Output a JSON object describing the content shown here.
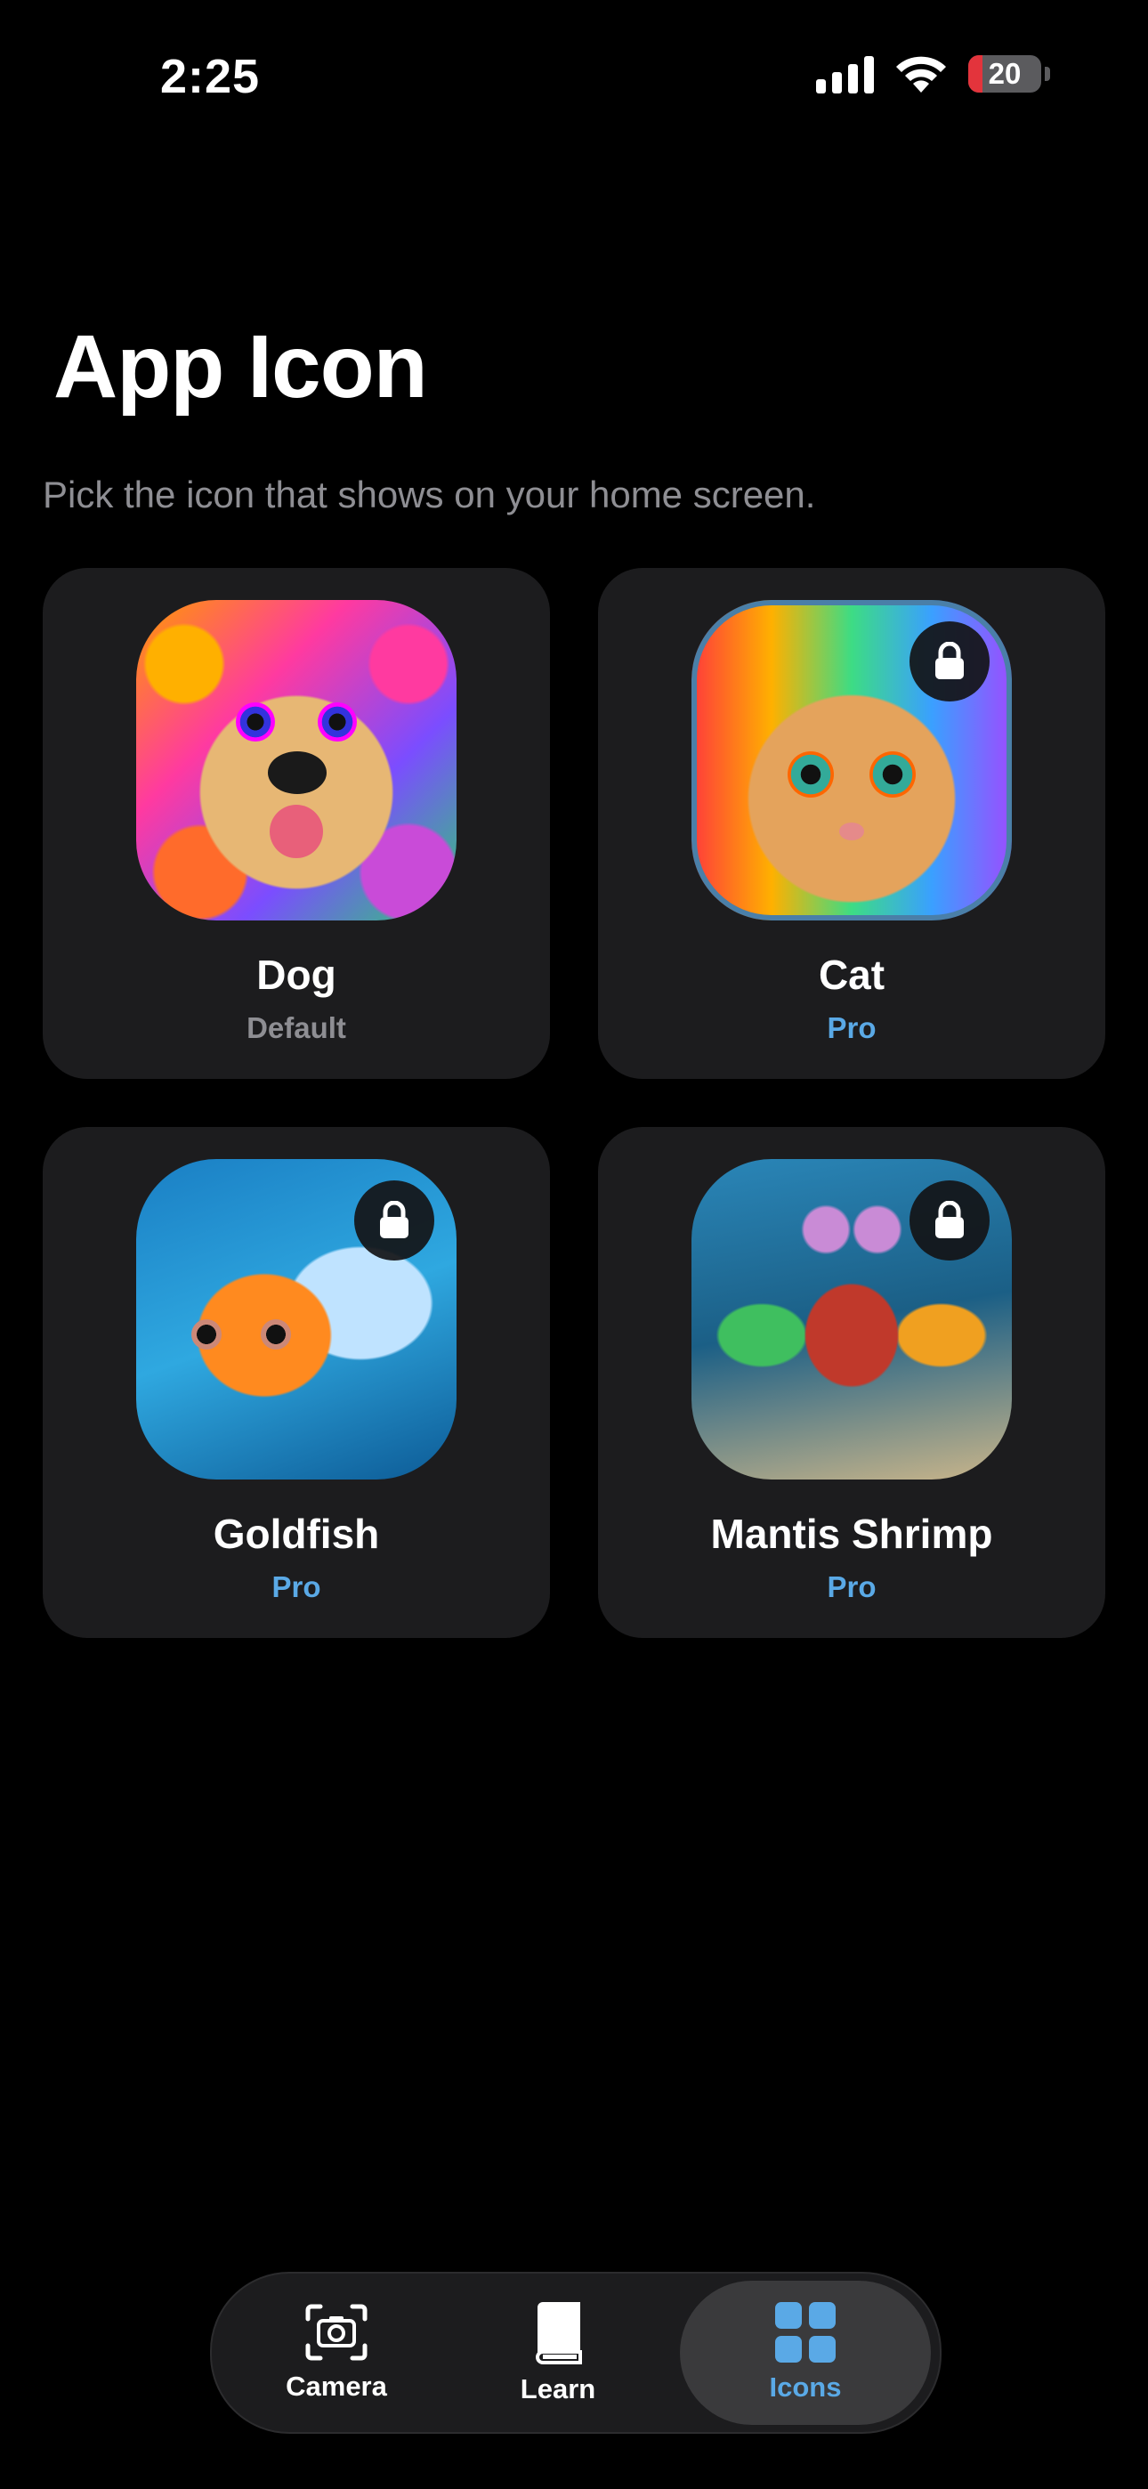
{
  "status_bar": {
    "time": "2:25",
    "battery_level": "20",
    "battery_fraction": 0.2
  },
  "page": {
    "title": "App Icon",
    "subtitle": "Pick the icon that shows on your home screen."
  },
  "icons": [
    {
      "name": "Dog",
      "tag": "Default",
      "locked": false,
      "selected": true
    },
    {
      "name": "Cat",
      "tag": "Pro",
      "locked": true,
      "selected": false
    },
    {
      "name": "Goldfish",
      "tag": "Pro",
      "locked": true,
      "selected": false
    },
    {
      "name": "Mantis Shrimp",
      "tag": "Pro",
      "locked": true,
      "selected": false
    }
  ],
  "tabbar": {
    "camera_label": "Camera",
    "learn_label": "Learn",
    "icons_label": "Icons",
    "active_tab": "Icons"
  },
  "colors": {
    "background": "#000000",
    "card": "#1c1c1e",
    "accent": "#5aa9e6",
    "secondary_text": "#8e8e93",
    "battery_low": "#e3343c"
  }
}
